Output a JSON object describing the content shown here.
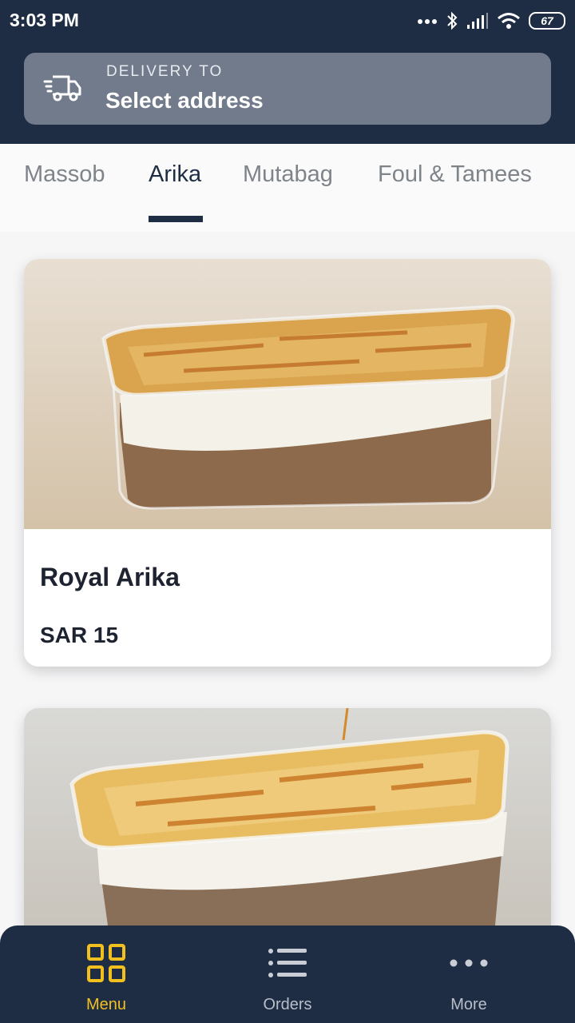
{
  "status_bar": {
    "time": "3:03 PM",
    "battery": "67"
  },
  "delivery": {
    "caption": "DELIVERY TO",
    "address": "Select address",
    "icon": "truck-icon"
  },
  "tabs": [
    {
      "label": "Massob",
      "active": false
    },
    {
      "label": "Arika",
      "active": true
    },
    {
      "label": "Mutabag",
      "active": false
    },
    {
      "label": "Foul & Tamees",
      "active": false
    }
  ],
  "products": [
    {
      "name": "Royal Arika",
      "price": "SAR 15"
    },
    {
      "name": "",
      "price": ""
    }
  ],
  "bottom_nav": [
    {
      "label": "Menu",
      "icon": "grid-icon",
      "active": true
    },
    {
      "label": "Orders",
      "icon": "list-icon",
      "active": false
    },
    {
      "label": "More",
      "icon": "more-dots-icon",
      "active": false
    }
  ],
  "colors": {
    "header": "#1f2d44",
    "accent": "#f2c01e"
  }
}
